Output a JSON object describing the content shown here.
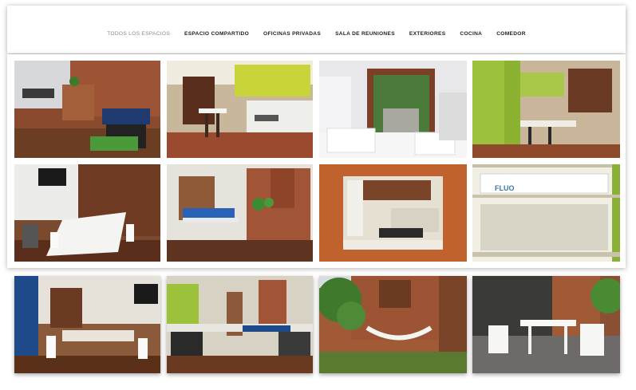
{
  "nav": {
    "items": [
      {
        "label": "TODOS LOS ESPACIOS",
        "active": true
      },
      {
        "label": "ESPACIO COMPARTIDO",
        "active": false
      },
      {
        "label": "OFICINAS PRIVADAS",
        "active": false
      },
      {
        "label": "SALA DE REUNIONES",
        "active": false
      },
      {
        "label": "EXTERIORES",
        "active": false
      },
      {
        "label": "COCINA",
        "active": false
      },
      {
        "label": "COMEDOR",
        "active": false
      }
    ]
  },
  "gallery": {
    "photos": [
      {
        "subject": "coworking-brick-room"
      },
      {
        "subject": "kitchen-yellow-cabinets"
      },
      {
        "subject": "patio-view-chairs"
      },
      {
        "subject": "kitchen-green-cabinets"
      },
      {
        "subject": "meeting-room-wood"
      },
      {
        "subject": "office-brick-planter"
      },
      {
        "subject": "kitchen-pass-through"
      },
      {
        "subject": "glasses-shelf"
      },
      {
        "subject": "meeting-room-blue-wall"
      },
      {
        "subject": "office-green-wall"
      },
      {
        "subject": "garden-hammock"
      },
      {
        "subject": "patio-white-furniture"
      }
    ],
    "shelf_brand": "FLUO"
  }
}
